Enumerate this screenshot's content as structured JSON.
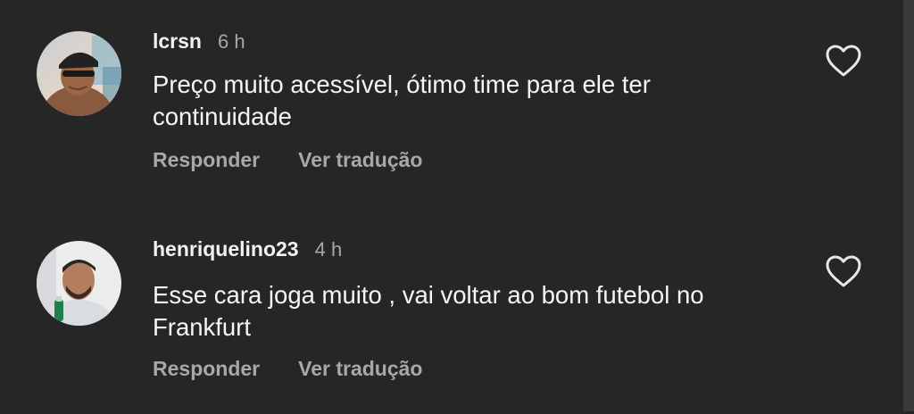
{
  "comments": [
    {
      "username": "lcrsn",
      "time": "6 h",
      "text": "Preço muito acessível, ótimo time para ele ter continuidade",
      "reply_label": "Responder",
      "translate_label": "Ver tradução",
      "avatar_icon": "user-photo-avatar",
      "like_icon": "heart-outline-icon"
    },
    {
      "username": "henriquelino23",
      "time": "4 h",
      "text": "Esse cara joga muito , vai voltar ao bom futebol no Frankfurt",
      "reply_label": "Responder",
      "translate_label": "Ver tradução",
      "avatar_icon": "user-photo-avatar",
      "like_icon": "heart-outline-icon"
    }
  ],
  "colors": {
    "background": "#262626",
    "primary_text": "#f5f5f5",
    "secondary_text": "#a8a8a8"
  }
}
